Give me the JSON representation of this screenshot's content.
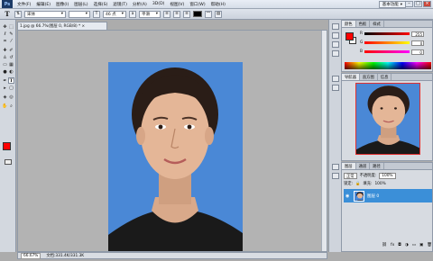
{
  "menu": {
    "logo": "Ps",
    "items": [
      "文件(F)",
      "编辑(E)",
      "图像(I)",
      "图层(L)",
      "选择(S)",
      "滤镜(T)",
      "分析(A)",
      "3D(D)",
      "视图(V)",
      "窗口(W)",
      "帮助(H)"
    ],
    "workspace": "基本功能",
    "win_min": "–",
    "win_max": "□",
    "win_close": "×"
  },
  "options": {
    "tool_glyph": "T",
    "font_family": "宋体",
    "font_size": "46 点",
    "antialias": "平滑"
  },
  "document": {
    "tab_title": "1.jpg @ 66.7%(图层 0, RGB/8) *",
    "zoom": "66.67%",
    "doc_info": "文档:331.4K/331.3K"
  },
  "color_panel": {
    "tabs": [
      "颜色",
      "色板",
      "样式"
    ],
    "r_label": "R",
    "g_label": "G",
    "b_label": "B",
    "r_value": "255",
    "g_value": "0",
    "b_value": "0"
  },
  "navigator_panel": {
    "tabs": [
      "导航器",
      "直方图",
      "信息"
    ]
  },
  "layers_panel": {
    "tabs": [
      "图层",
      "通道",
      "路径"
    ],
    "blend_mode": "正常",
    "opacity_label": "不透明度:",
    "opacity_value": "100%",
    "lock_label": "锁定:",
    "fill_label": "填充:",
    "fill_value": "100%",
    "layer_name": "图层 0"
  },
  "colors": {
    "foreground": "#ff0000",
    "background": "#ffffff",
    "photo_bg": "#4a88d6",
    "layer_highlight": "#3b8fd8"
  }
}
